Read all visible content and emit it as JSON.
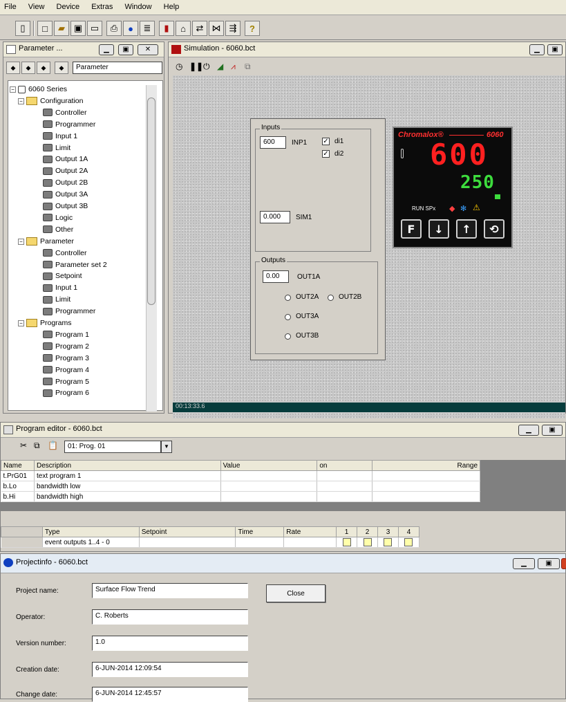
{
  "menu": [
    "File",
    "View",
    "Device",
    "Extras",
    "Window",
    "Help"
  ],
  "toolbar_icons": [
    "new-page-icon",
    "new-document-icon",
    "open-folder-icon",
    "save-icon",
    "screen-icon",
    "print-icon",
    "info-icon",
    "list-icon",
    "device-icon",
    "program-icon",
    "link-icon",
    "trend-icon",
    "connect-icon",
    "help-icon"
  ],
  "parameter_window": {
    "title": "Parameter ...",
    "combo_value": "Parameter",
    "tree": [
      {
        "label": "6060 Series",
        "level": 0,
        "kind": "root"
      },
      {
        "label": "Configuration",
        "level": 1,
        "kind": "folder"
      },
      {
        "label": "Controller",
        "level": 2,
        "kind": "leaf"
      },
      {
        "label": "Programmer",
        "level": 2,
        "kind": "leaf"
      },
      {
        "label": "Input 1",
        "level": 2,
        "kind": "leaf"
      },
      {
        "label": "Limit",
        "level": 2,
        "kind": "leaf"
      },
      {
        "label": "Output 1A",
        "level": 2,
        "kind": "leaf"
      },
      {
        "label": "Output 2A",
        "level": 2,
        "kind": "leaf"
      },
      {
        "label": "Output 2B",
        "level": 2,
        "kind": "leaf"
      },
      {
        "label": "Output 3A",
        "level": 2,
        "kind": "leaf"
      },
      {
        "label": "Output 3B",
        "level": 2,
        "kind": "leaf"
      },
      {
        "label": "Logic",
        "level": 2,
        "kind": "leaf"
      },
      {
        "label": "Other",
        "level": 2,
        "kind": "leaf"
      },
      {
        "label": "Parameter",
        "level": 1,
        "kind": "folder"
      },
      {
        "label": "Controller",
        "level": 2,
        "kind": "leaf"
      },
      {
        "label": "Parameter set 2",
        "level": 2,
        "kind": "leaf"
      },
      {
        "label": "Setpoint",
        "level": 2,
        "kind": "leaf"
      },
      {
        "label": "Input 1",
        "level": 2,
        "kind": "leaf"
      },
      {
        "label": "Limit",
        "level": 2,
        "kind": "leaf"
      },
      {
        "label": "Programmer",
        "level": 2,
        "kind": "leaf"
      },
      {
        "label": "Programs",
        "level": 1,
        "kind": "folder"
      },
      {
        "label": "Program 1",
        "level": 2,
        "kind": "leaf"
      },
      {
        "label": "Program 2",
        "level": 2,
        "kind": "leaf"
      },
      {
        "label": "Program 3",
        "level": 2,
        "kind": "leaf"
      },
      {
        "label": "Program 4",
        "level": 2,
        "kind": "leaf"
      },
      {
        "label": "Program 5",
        "level": 2,
        "kind": "leaf"
      },
      {
        "label": "Program 6",
        "level": 2,
        "kind": "leaf"
      }
    ]
  },
  "simulation_window": {
    "title": "Simulation - 6060.bct",
    "status_time": "00:13:33.6",
    "inputs": {
      "group_label": "Inputs",
      "inp1_value": "600",
      "inp1_label": "INP1",
      "di1_label": "di1",
      "di2_label": "di2",
      "di1_checked": true,
      "di2_checked": true,
      "sim1_value": "0.000",
      "sim1_label": "SIM1"
    },
    "outputs": {
      "group_label": "Outputs",
      "out1a_value": "0.00",
      "out1a_label": "OUT1A",
      "out2a_label": "OUT2A",
      "out2b_label": "OUT2B",
      "out3a_label": "OUT3A",
      "out3b_label": "OUT3B"
    },
    "controller": {
      "brand": "Chromalox®",
      "model": "6060",
      "process_value": "600",
      "setpoint_value": "250",
      "status_text": "RUN SPx",
      "buttons": [
        "F",
        "↓",
        "↑",
        "⟲"
      ],
      "colors": {
        "pv": "#ff2020",
        "sp": "#3ddc3d",
        "brand": "#ff3030"
      }
    }
  },
  "program_editor": {
    "title": "Program editor - 6060.bct",
    "program_select": "01: Prog. 01",
    "param_headers": [
      "Name",
      "Description",
      "Value",
      "on",
      "Range"
    ],
    "param_rows": [
      [
        "t.PrG01",
        "text program 1",
        "",
        "",
        ""
      ],
      [
        "b.Lo",
        "bandwidth low",
        "",
        "",
        ""
      ],
      [
        "b.Hi",
        "bandwidth high",
        "",
        "",
        ""
      ]
    ],
    "segment_headers": [
      "Type",
      "Setpoint",
      "Time",
      "Rate",
      "1",
      "2",
      "3",
      "4"
    ],
    "segment_row": [
      "event outputs 1..4 - 0",
      "",
      "",
      ""
    ]
  },
  "project_info": {
    "title": "Projectinfo - 6060.bct",
    "close_label": "Close",
    "fields": [
      {
        "label": "Project name:",
        "value": "Surface Flow Trend"
      },
      {
        "label": "Operator:",
        "value": "C. Roberts"
      },
      {
        "label": "Version number:",
        "value": "1.0"
      },
      {
        "label": "Creation date:",
        "value": "6-JUN-2014 12:09:54"
      },
      {
        "label": "Change date:",
        "value": "6-JUN-2014 12:45:57"
      }
    ]
  }
}
